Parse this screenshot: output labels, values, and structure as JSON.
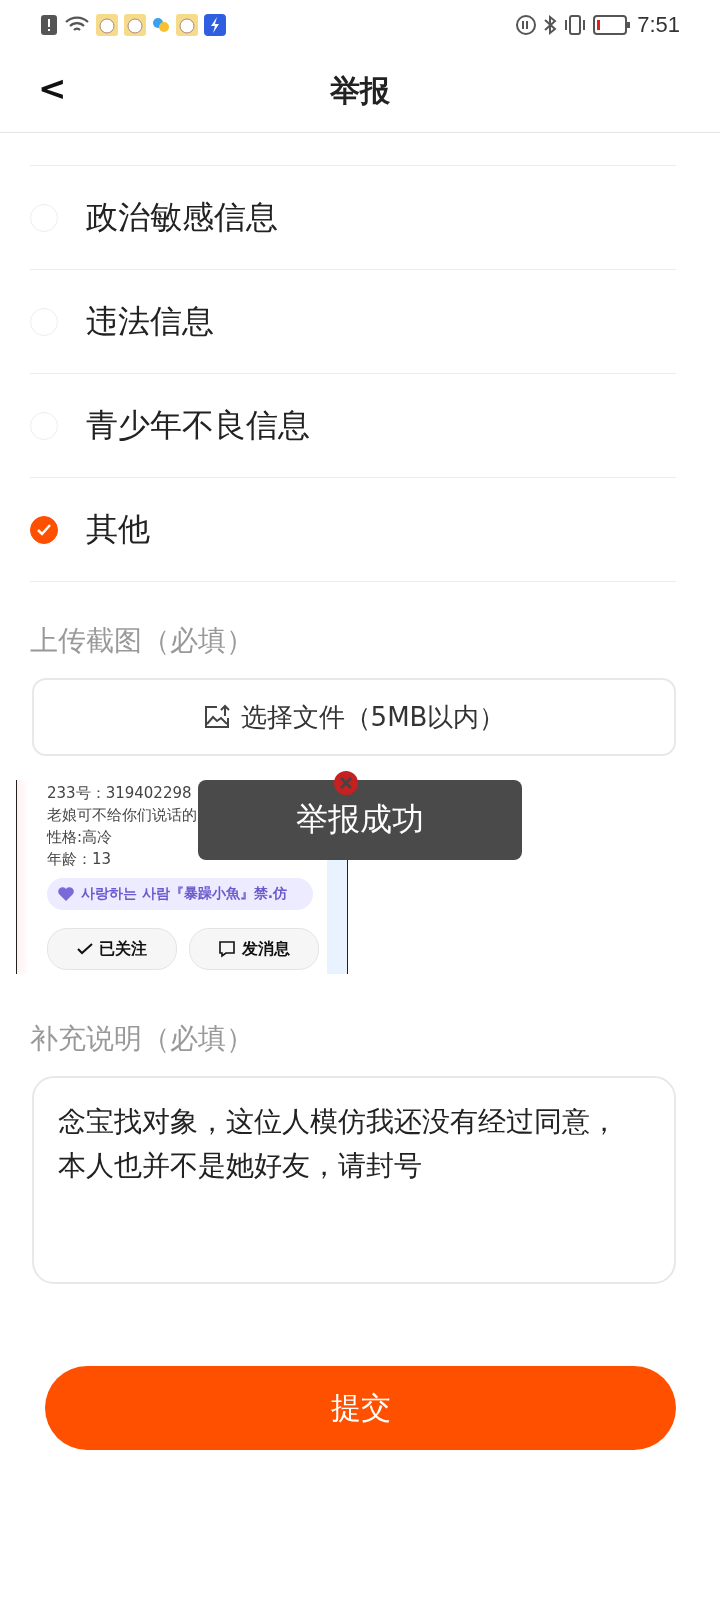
{
  "status_bar": {
    "time": "7:51"
  },
  "header": {
    "back": "<",
    "title": "举报"
  },
  "reasons": [
    {
      "label": "政治敏感信息",
      "selected": false
    },
    {
      "label": "违法信息",
      "selected": false
    },
    {
      "label": "青少年不良信息",
      "selected": false
    },
    {
      "label": "其他",
      "selected": true
    }
  ],
  "upload": {
    "label": "上传截图（必填）",
    "button": "选择文件（5MB以内）",
    "screenshot": {
      "id_line": "233号：319402298",
      "bio": "老娘可不给你们说话的",
      "trait": "性格:高冷",
      "age": "年龄：13",
      "relation": "사랑하는 사람『暴躁小魚』禁.仿",
      "follow": "已关注",
      "message": "发消息"
    }
  },
  "note": {
    "label": "补充说明（必填）",
    "value": "念宝找对象，这位人模仿我还没有经过同意，本人也并不是她好友，请封号"
  },
  "submit": "提交",
  "toast": "举报成功"
}
